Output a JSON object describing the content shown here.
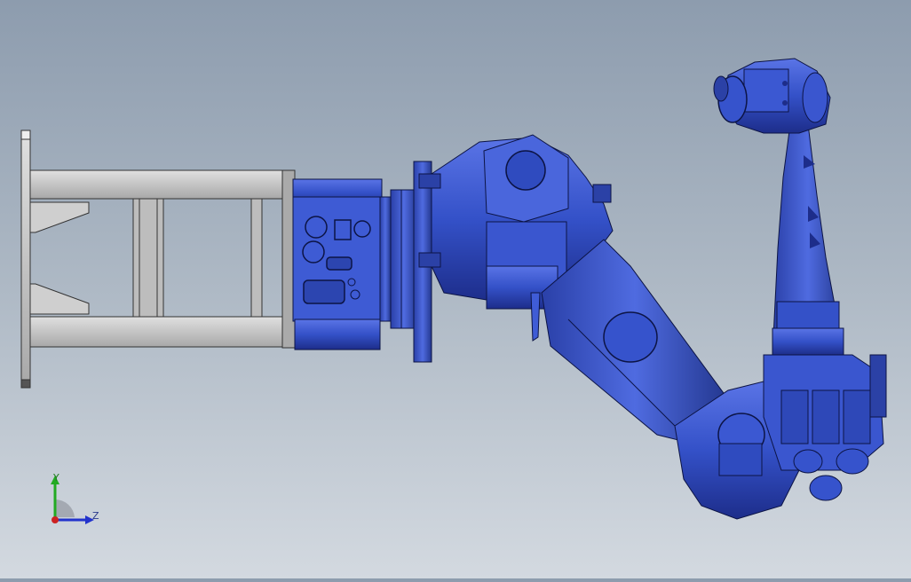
{
  "viewport": {
    "background_top": "#8d9cae",
    "background_bottom": "#d3d9e0",
    "model_color": "#3451c8",
    "model_dark": "#1d2d8a",
    "frame_color": "#c9c9c9"
  },
  "triad": {
    "y_label": "Y",
    "z_label": "Z",
    "y_color": "#22aa22",
    "z_color": "#2233cc",
    "x_color": "#cc2222"
  }
}
